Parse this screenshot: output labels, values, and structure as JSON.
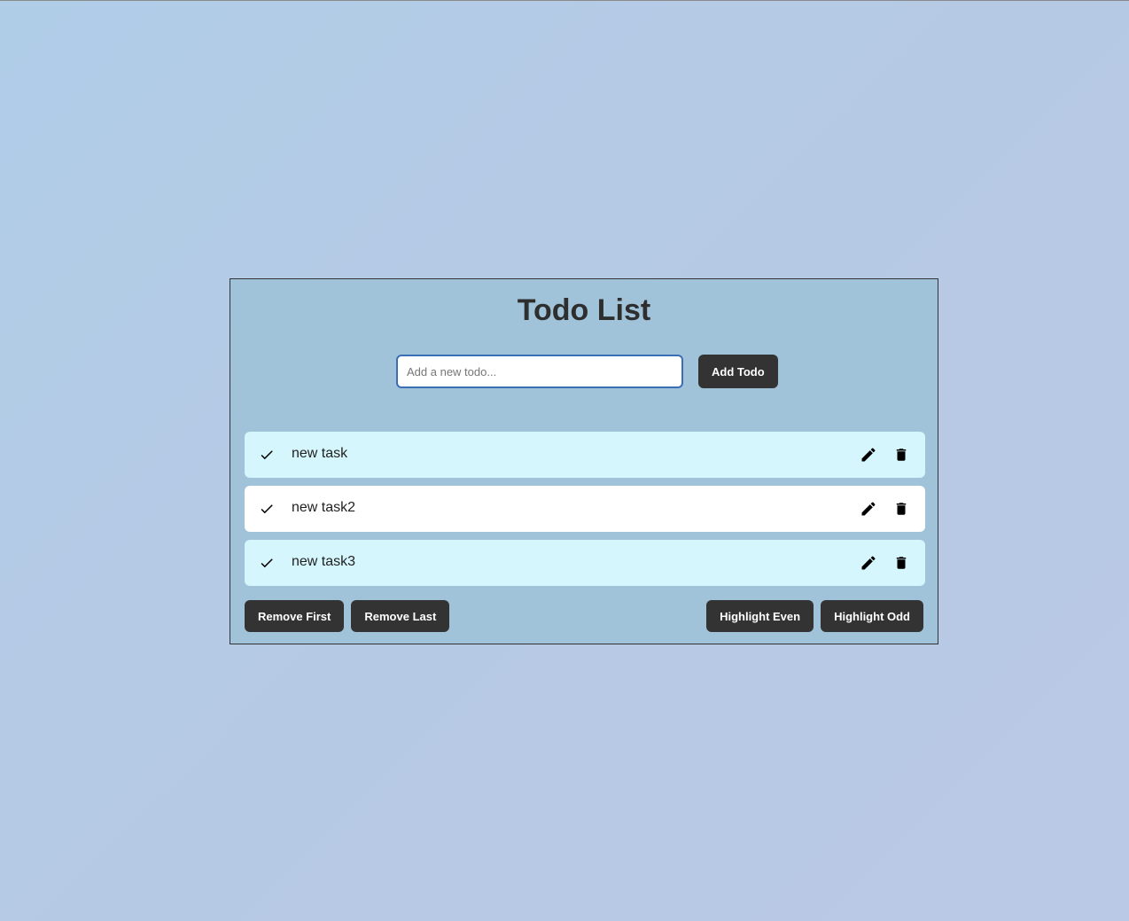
{
  "title": "Todo List",
  "input": {
    "placeholder": "Add a new todo...",
    "value": ""
  },
  "add_button": "Add Todo",
  "todos": [
    {
      "text": "new task",
      "highlighted": true,
      "check_icon": "check-icon",
      "edit_icon": "pencil-icon",
      "delete_icon": "trash-icon"
    },
    {
      "text": "new task2",
      "highlighted": false,
      "check_icon": "check-icon",
      "edit_icon": "pencil-icon",
      "delete_icon": "trash-icon"
    },
    {
      "text": "new task3",
      "highlighted": true,
      "check_icon": "check-icon",
      "edit_icon": "pencil-icon",
      "delete_icon": "trash-icon"
    }
  ],
  "actions": {
    "remove_first": "Remove First",
    "remove_last": "Remove Last",
    "highlight_even": "Highlight Even",
    "highlight_odd": "Highlight Odd"
  },
  "colors": {
    "card_bg": "#a0c3da",
    "highlight_bg": "#d5f6fd",
    "button_bg": "#333333",
    "input_border": "#3a6fb5"
  }
}
